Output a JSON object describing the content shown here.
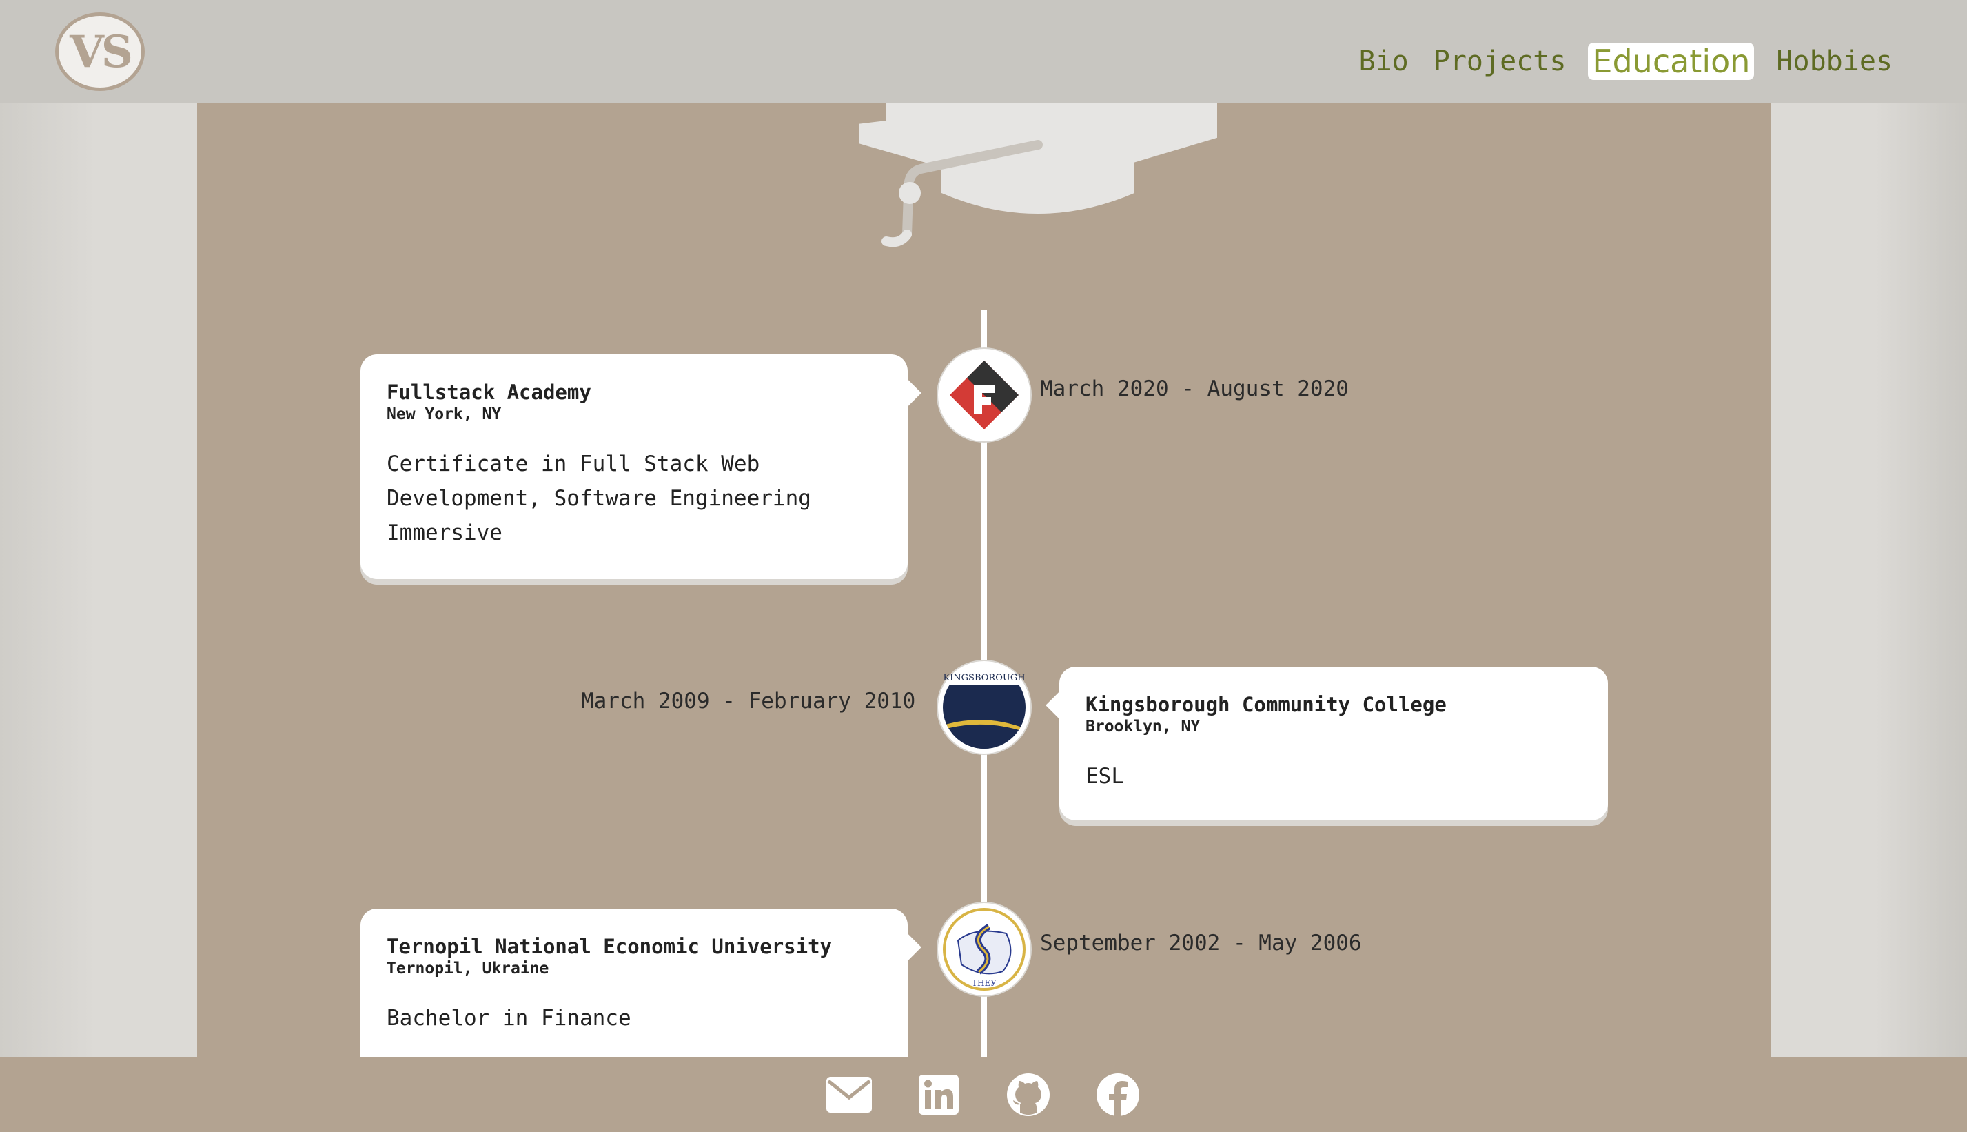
{
  "header": {
    "logo_text": "VS",
    "nav": [
      {
        "label": "Bio",
        "active": false
      },
      {
        "label": "Projects",
        "active": false
      },
      {
        "label": "Education",
        "active": true
      },
      {
        "label": "Hobbies",
        "active": false
      }
    ]
  },
  "education": [
    {
      "school": "Fullstack Academy",
      "location": "New York, NY",
      "degree": "Certificate in Full Stack Web Development, Software Engineering Immersive",
      "dates": "March 2020 - August 2020",
      "badge_icon": "fullstack-logo-icon"
    },
    {
      "school": "Kingsborough Community College",
      "location": "Brooklyn, NY",
      "degree": "ESL",
      "dates": "March 2009 - February 2010",
      "badge_icon": "kingsborough-seal-icon",
      "badge_text": "KINGSBOROUGH"
    },
    {
      "school": "Ternopil National Economic University",
      "location": "Ternopil, Ukraine",
      "degree": "Bachelor in Finance",
      "dates": "September 2002 - May 2006",
      "badge_icon": "tneu-seal-icon",
      "badge_text": "ТНЕУ"
    }
  ],
  "footer": {
    "icons": [
      "email-icon",
      "linkedin-icon",
      "github-icon",
      "facebook-icon"
    ]
  },
  "colors": {
    "panel": "#b3a391",
    "header": "#c8c6c1",
    "nav_text": "#5e6b23",
    "nav_active": "#8a9a34"
  }
}
